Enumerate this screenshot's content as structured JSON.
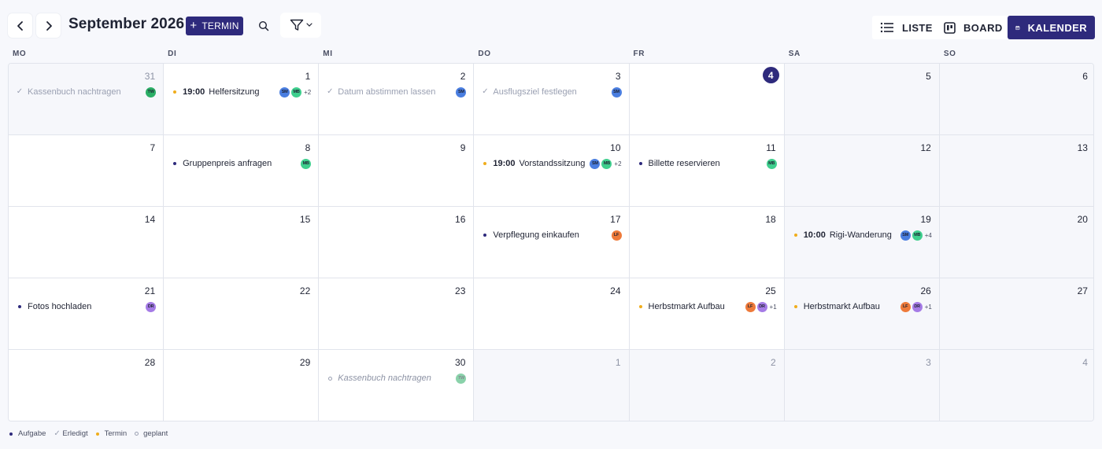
{
  "toolbar": {
    "month_title": "September 2026",
    "add_button_label": "TERMIN",
    "views": [
      {
        "label": "LISTE",
        "icon": "list-icon",
        "active": false
      },
      {
        "label": "BOARD",
        "icon": "board-icon",
        "active": false
      },
      {
        "label": "KALENDER",
        "icon": "calendar-icon",
        "active": true
      }
    ]
  },
  "colors": {
    "accent": "#2e2a7c",
    "task_dot": "#2e2a7c",
    "appointment_dot": "#f0ad1c",
    "avatar_SM": "#4a7ee0",
    "avatar_MB": "#3fcf8e",
    "avatar_TW": "#2bae66",
    "avatar_LF": "#ee7a3a",
    "avatar_DR": "#a57be6"
  },
  "weekdays": [
    "MO",
    "DI",
    "MI",
    "DO",
    "FR",
    "SA",
    "SO"
  ],
  "weeks": [
    [
      {
        "day": "31",
        "outside": true,
        "events": [
          {
            "kind": "done",
            "title": "Kassenbuch nachtragen",
            "avatars": [
              "TW"
            ]
          }
        ]
      },
      {
        "day": "1",
        "events": [
          {
            "kind": "appt",
            "time": "19:00",
            "title": "Helfersitzung",
            "avatars": [
              "SM",
              "MB"
            ],
            "more": "+2"
          }
        ]
      },
      {
        "day": "2",
        "events": [
          {
            "kind": "done",
            "title": "Datum abstimmen lassen",
            "avatars": [
              "SM"
            ]
          }
        ]
      },
      {
        "day": "3",
        "events": [
          {
            "kind": "done",
            "title": "Ausflugsziel festlegen",
            "avatars": [
              "SM"
            ]
          }
        ]
      },
      {
        "day": "4",
        "today": true,
        "events": []
      },
      {
        "day": "5",
        "events": []
      },
      {
        "day": "6",
        "events": []
      }
    ],
    [
      {
        "day": "7",
        "events": []
      },
      {
        "day": "8",
        "events": [
          {
            "kind": "task",
            "title": "Gruppenpreis anfragen",
            "avatars": [
              "MB"
            ]
          }
        ]
      },
      {
        "day": "9",
        "events": []
      },
      {
        "day": "10",
        "events": [
          {
            "kind": "appt",
            "time": "19:00",
            "title": "Vorstandssitzung",
            "avatars": [
              "SM",
              "MB"
            ],
            "more": "+2"
          }
        ]
      },
      {
        "day": "11",
        "events": [
          {
            "kind": "task",
            "title": "Billette reservieren",
            "avatars": [
              "MB"
            ]
          }
        ]
      },
      {
        "day": "12",
        "events": []
      },
      {
        "day": "13",
        "events": []
      }
    ],
    [
      {
        "day": "14",
        "events": []
      },
      {
        "day": "15",
        "events": []
      },
      {
        "day": "16",
        "events": []
      },
      {
        "day": "17",
        "events": [
          {
            "kind": "task",
            "title": "Verpflegung einkaufen",
            "avatars": [
              "LF"
            ]
          }
        ]
      },
      {
        "day": "18",
        "events": []
      },
      {
        "day": "19",
        "events": [
          {
            "kind": "appt",
            "time": "10:00",
            "title": "Rigi-Wanderung",
            "avatars": [
              "SM",
              "MB"
            ],
            "more": "+4"
          }
        ]
      },
      {
        "day": "20",
        "events": []
      }
    ],
    [
      {
        "day": "21",
        "events": [
          {
            "kind": "task",
            "title": "Fotos hochladen",
            "avatars": [
              "DR"
            ]
          }
        ]
      },
      {
        "day": "22",
        "events": []
      },
      {
        "day": "23",
        "events": []
      },
      {
        "day": "24",
        "events": []
      },
      {
        "day": "25",
        "events": [
          {
            "kind": "appt",
            "title": "Herbstmarkt Aufbau",
            "avatars": [
              "LF",
              "DR"
            ],
            "more": "+1"
          }
        ]
      },
      {
        "day": "26",
        "events": [
          {
            "kind": "appt",
            "title": "Herbstmarkt Aufbau",
            "avatars": [
              "LF",
              "DR"
            ],
            "more": "+1"
          }
        ]
      },
      {
        "day": "27",
        "events": []
      }
    ],
    [
      {
        "day": "28",
        "events": []
      },
      {
        "day": "29",
        "events": []
      },
      {
        "day": "30",
        "events": [
          {
            "kind": "planned",
            "title": "Kassenbuch nachtragen",
            "avatars": [
              "TW"
            ]
          }
        ]
      },
      {
        "day": "1",
        "outside": true,
        "events": []
      },
      {
        "day": "2",
        "outside": true,
        "events": []
      },
      {
        "day": "3",
        "outside": true,
        "events": []
      },
      {
        "day": "4",
        "outside": true,
        "events": []
      }
    ]
  ],
  "legend": [
    {
      "kind": "task",
      "label": "Aufgabe"
    },
    {
      "kind": "done",
      "label": "Erledigt"
    },
    {
      "kind": "appt",
      "label": "Termin"
    },
    {
      "kind": "planned",
      "label": "geplant"
    }
  ]
}
